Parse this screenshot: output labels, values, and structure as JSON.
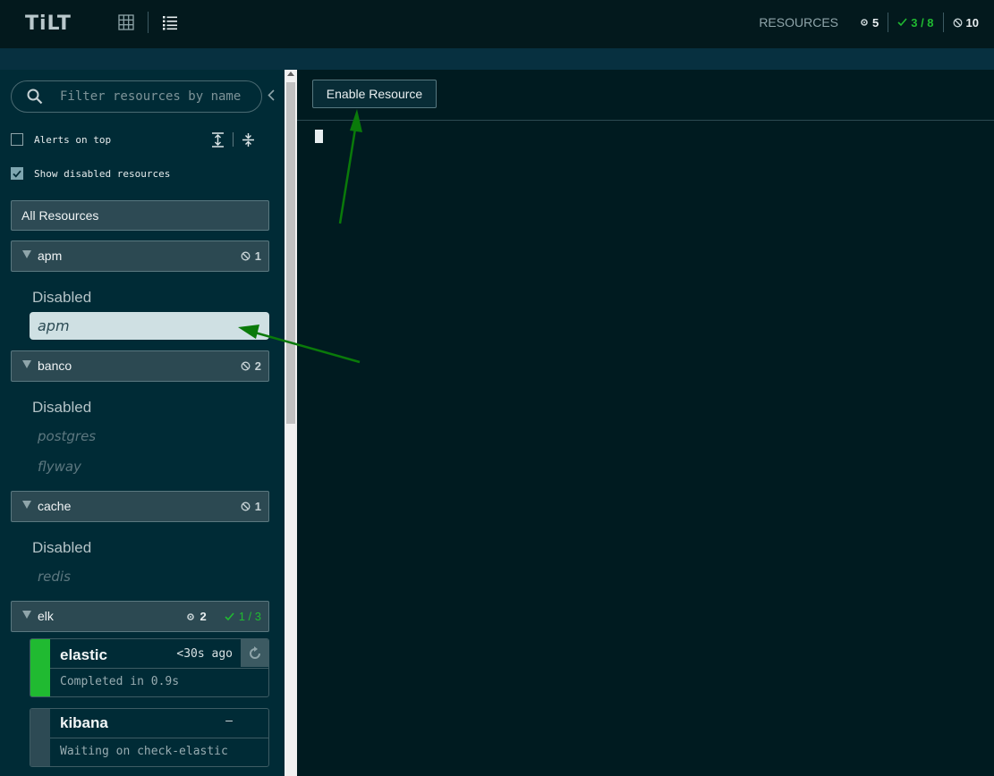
{
  "header": {
    "logo": "TiLT",
    "resources_label": "RESOURCES",
    "building_count": "5",
    "healthy_ratio": "3 / 8",
    "disabled_count": "10"
  },
  "sidebar": {
    "search_placeholder": "Filter resources by name",
    "alerts_on_top_label": "Alerts on top",
    "alerts_on_top_checked": false,
    "show_disabled_label": "Show disabled resources",
    "show_disabled_checked": true,
    "all_resources_label": "All Resources",
    "groups": [
      {
        "name": "apm",
        "disabled_count": "1",
        "section_label": "Disabled",
        "items": [
          "apm"
        ]
      },
      {
        "name": "banco",
        "disabled_count": "2",
        "section_label": "Disabled",
        "items": [
          "postgres",
          "flyway"
        ]
      },
      {
        "name": "cache",
        "disabled_count": "1",
        "section_label": "Disabled",
        "items": [
          "redis"
        ]
      },
      {
        "name": "elk",
        "building_count": "2",
        "healthy_ratio": "1 / 3",
        "cards": [
          {
            "name": "elastic",
            "time": "<30s ago",
            "status": "Completed in 0.9s",
            "status_color": "#20ba31"
          },
          {
            "name": "kibana",
            "time": "–",
            "status": "Waiting on check-elastic",
            "status_color": "#2d4a54"
          }
        ]
      }
    ]
  },
  "main": {
    "enable_button_label": "Enable Resource"
  },
  "colors": {
    "green": "#20ba31",
    "arrow": "#0a7a0a",
    "selected_bg": "#cfe0e3"
  }
}
